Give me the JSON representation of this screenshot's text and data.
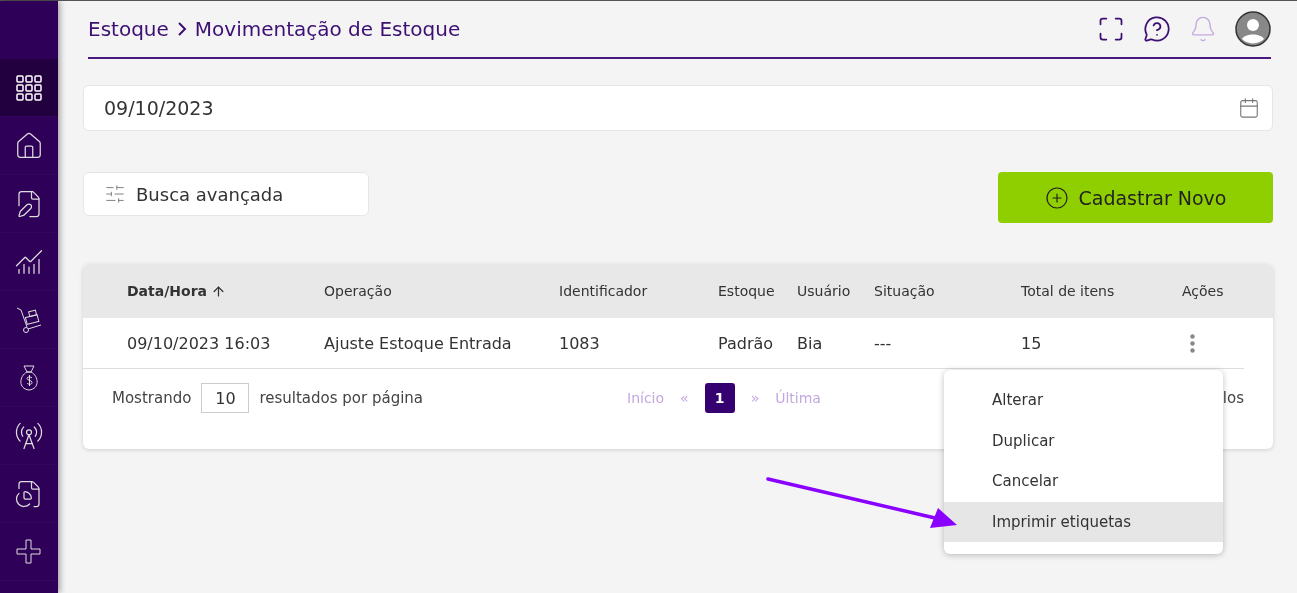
{
  "sidebar": {
    "items": [
      {
        "kind": "grid",
        "selected": true
      },
      {
        "kind": "home",
        "selected": false
      },
      {
        "kind": "document",
        "selected": false
      },
      {
        "kind": "chart",
        "selected": false
      },
      {
        "kind": "cart",
        "selected": false
      },
      {
        "kind": "money",
        "selected": false
      },
      {
        "kind": "antenna",
        "selected": false
      },
      {
        "kind": "report",
        "selected": false
      },
      {
        "kind": "cross",
        "selected": false
      }
    ]
  },
  "breadcrumb": [
    "Estoque",
    "Movimentação de Estoque"
  ],
  "date_field": {
    "value": "09/10/2023"
  },
  "search_button": "Busca avançada",
  "new_button": "Cadastrar Novo",
  "table": {
    "columns": [
      {
        "label": "Data/Hora",
        "sorted": true
      },
      {
        "label": "Operação",
        "sorted": false
      },
      {
        "label": "Identificador",
        "sorted": false
      },
      {
        "label": "Estoque",
        "sorted": false
      },
      {
        "label": "Usuário",
        "sorted": false
      },
      {
        "label": "Situação",
        "sorted": false
      },
      {
        "label": "Total de itens",
        "sorted": false
      },
      {
        "label": "Ações",
        "sorted": false
      }
    ],
    "rows": [
      {
        "cells": [
          "09/10/2023 16:03",
          "Ajuste Estoque Entrada",
          "1083",
          "Padrão",
          "Bia",
          "---",
          "15"
        ]
      }
    ]
  },
  "footer": {
    "showing": "Mostrando",
    "page_size": "10",
    "per_page": "resultados por página",
    "pages": [
      {
        "label": "Início",
        "kind": "link"
      },
      {
        "label": "«",
        "kind": "link"
      },
      {
        "label": "1",
        "kind": "page",
        "selected": true
      },
      {
        "label": "»",
        "kind": "link"
      },
      {
        "label": "Última",
        "kind": "link"
      }
    ],
    "total": "los"
  },
  "menu": [
    {
      "label": "Alterar",
      "selected": false
    },
    {
      "label": "Duplicar",
      "selected": false
    },
    {
      "label": "Cancelar",
      "selected": false
    },
    {
      "label": "Imprimir etiquetas",
      "selected": true
    }
  ]
}
